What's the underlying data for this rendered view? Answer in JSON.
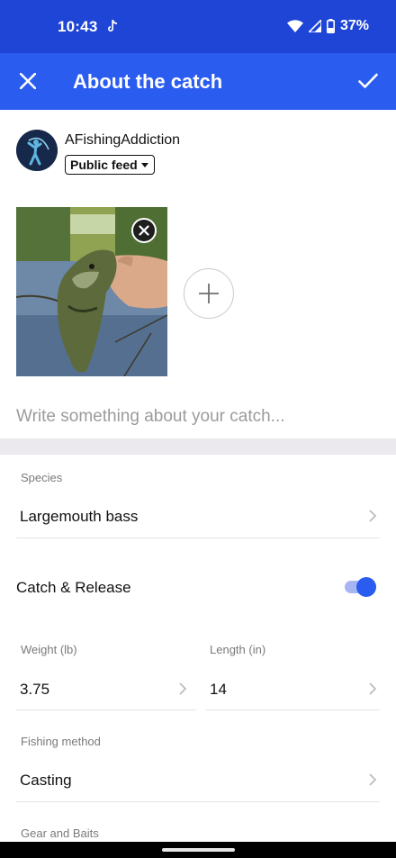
{
  "status_bar": {
    "time": "10:43",
    "battery": "37%"
  },
  "header": {
    "title": "About the catch"
  },
  "user": {
    "name": "AFishingAddiction",
    "feed_option": "Public feed"
  },
  "caption": {
    "placeholder": "Write something about your catch...",
    "value": ""
  },
  "fields": {
    "species": {
      "label": "Species",
      "value": "Largemouth bass"
    },
    "catch_release": {
      "label": "Catch & Release",
      "enabled": true
    },
    "weight": {
      "label": "Weight (lb)",
      "value": "3.75"
    },
    "length": {
      "label": "Length (in)",
      "value": "14"
    },
    "method": {
      "label": "Fishing method",
      "value": "Casting"
    },
    "gear": {
      "label": "Gear and Baits"
    }
  },
  "colors": {
    "status_bar": "#1f45d6",
    "app_bar": "#2a5cf0",
    "accent": "#2a5cf0",
    "divider": "#ebe9ed"
  }
}
